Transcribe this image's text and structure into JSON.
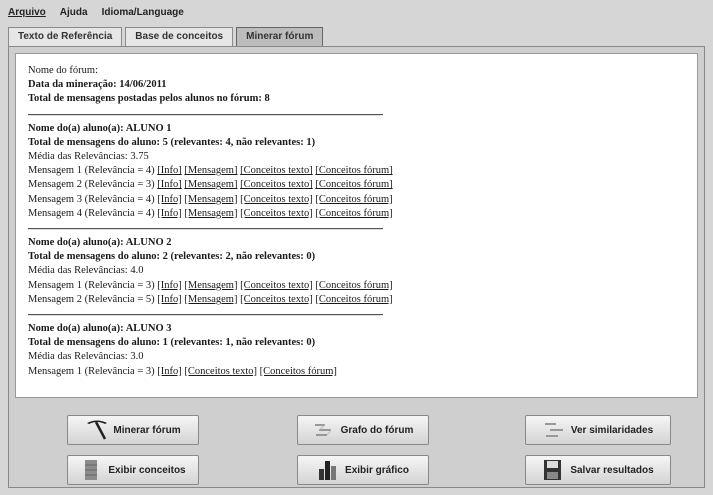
{
  "menu": {
    "file": "Arquivo",
    "help": "Ajuda",
    "language": "Idioma/Language"
  },
  "tabs": [
    {
      "label": "Texto de Referência",
      "active": false
    },
    {
      "label": "Base de conceitos",
      "active": false
    },
    {
      "label": "Minerar fórum",
      "active": true
    }
  ],
  "report": {
    "forum_name": "Nome do fórum:",
    "mining_date": "Data da mineração: 14/06/2011",
    "total_messages": "Total de mensagens postadas pelos alunos no fórum: 8",
    "students": [
      {
        "name": "Nome do(a) aluno(a): ALUNO 1",
        "total": "Total de mensagens do aluno: 5 (relevantes: 4, não relevantes: 1)",
        "avg": "Média das Relevâncias: 3.75",
        "messages": [
          {
            "label": "Mensagem 1 (Relevância = 4)",
            "links": [
              "[Info]",
              "[Mensagem]",
              "[Conceitos texto]",
              "[Conceitos fórum]"
            ]
          },
          {
            "label": "Mensagem 2 (Relevância = 3)",
            "links": [
              "[Info]",
              "[Mensagem]",
              "[Conceitos texto]",
              "[Conceitos fórum]"
            ]
          },
          {
            "label": "Mensagem 3 (Relevância = 4)",
            "links": [
              "[Info]",
              "[Mensagem]",
              "[Conceitos texto]",
              "[Conceitos fórum]"
            ]
          },
          {
            "label": "Mensagem 4 (Relevância = 4)",
            "links": [
              "[Info]",
              "[Mensagem]",
              "[Conceitos texto]",
              "[Conceitos fórum]"
            ]
          }
        ]
      },
      {
        "name": "Nome do(a) aluno(a): ALUNO 2",
        "total": "Total de mensagens do aluno: 2 (relevantes: 2, não relevantes: 0)",
        "avg": "Média das Relevâncias: 4.0",
        "messages": [
          {
            "label": "Mensagem 1 (Relevância = 3)",
            "links": [
              "[Info]",
              "[Mensagem]",
              "[Conceitos texto]",
              "[Conceitos fórum]"
            ]
          },
          {
            "label": "Mensagem 2 (Relevância = 5)",
            "links": [
              "[Info]",
              "[Mensagem]",
              "[Conceitos texto]",
              "[Conceitos fórum]"
            ]
          }
        ]
      },
      {
        "name": "Nome do(a) aluno(a): ALUNO 3",
        "total": "Total de mensagens do aluno: 1 (relevantes: 1, não relevantes: 0)",
        "avg": "Média das Relevâncias: 3.0",
        "messages": [
          {
            "label": "Mensagem 1 (Relevância = 3)",
            "links": [
              "[Info]",
              "[Conceitos texto]",
              "[Conceitos fórum]"
            ]
          }
        ]
      }
    ]
  },
  "buttons": {
    "mine_forum": "Minerar fórum",
    "forum_graph": "Grafo do fórum",
    "similarities": "Ver similaridades",
    "show_concepts": "Exibir conceitos",
    "show_chart": "Exibir gráfico",
    "save_results": "Salvar resultados"
  }
}
